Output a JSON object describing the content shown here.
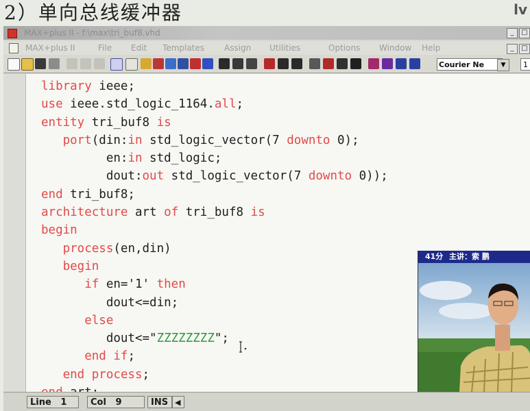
{
  "slide": {
    "title": "2）单向总线缓冲器",
    "corner_text": "lv"
  },
  "window": {
    "title": "MAX+plus II - f:\\max\\tri_buf8.vhd"
  },
  "menu": [
    "MAX+plus II",
    "File",
    "Edit",
    "Templates",
    "Assign",
    "Utilities",
    "Options",
    "Window",
    "Help"
  ],
  "toolbar": {
    "font_name": "Courier Ne",
    "font_size": "1"
  },
  "code_lines": [
    [
      {
        "t": "library",
        "k": "kw"
      },
      {
        "t": " ieee;"
      }
    ],
    [
      {
        "t": "use",
        "k": "kw"
      },
      {
        "t": " ieee.std_logic_1164."
      },
      {
        "t": "all",
        "k": "kw"
      },
      {
        "t": ";"
      }
    ],
    [
      {
        "t": "entity",
        "k": "kw"
      },
      {
        "t": " tri_buf8 "
      },
      {
        "t": "is",
        "k": "kw"
      }
    ],
    [
      {
        "t": "   "
      },
      {
        "t": "port",
        "k": "kw"
      },
      {
        "t": "(din:"
      },
      {
        "t": "in",
        "k": "kw"
      },
      {
        "t": " std_logic_vector(7 "
      },
      {
        "t": "downto",
        "k": "kw"
      },
      {
        "t": " 0);"
      }
    ],
    [
      {
        "t": "         en:"
      },
      {
        "t": "in",
        "k": "kw"
      },
      {
        "t": " std_logic;"
      }
    ],
    [
      {
        "t": "         dout:"
      },
      {
        "t": "out",
        "k": "kw"
      },
      {
        "t": " std_logic_vector(7 "
      },
      {
        "t": "downto",
        "k": "kw"
      },
      {
        "t": " 0));"
      }
    ],
    [
      {
        "t": "end",
        "k": "kw"
      },
      {
        "t": " tri_buf8;"
      }
    ],
    [
      {
        "t": "architecture",
        "k": "kw"
      },
      {
        "t": " art "
      },
      {
        "t": "of",
        "k": "kw"
      },
      {
        "t": " tri_buf8 "
      },
      {
        "t": "is",
        "k": "kw"
      }
    ],
    [
      {
        "t": "begin",
        "k": "kw"
      }
    ],
    [
      {
        "t": "   "
      },
      {
        "t": "process",
        "k": "kw"
      },
      {
        "t": "(en,din)"
      }
    ],
    [
      {
        "t": "   "
      },
      {
        "t": "begin",
        "k": "kw"
      }
    ],
    [
      {
        "t": "      "
      },
      {
        "t": "if",
        "k": "kw"
      },
      {
        "t": " en='1' "
      },
      {
        "t": "then",
        "k": "kw"
      }
    ],
    [
      {
        "t": "         dout<=din;"
      }
    ],
    [
      {
        "t": "      "
      },
      {
        "t": "else",
        "k": "kw"
      }
    ],
    [
      {
        "t": "         dout<=\""
      },
      {
        "t": "ZZZZZZZZ",
        "k": "str"
      },
      {
        "t": "\";"
      }
    ],
    [
      {
        "t": "      "
      },
      {
        "t": "end if",
        "k": "kw"
      },
      {
        "t": ";"
      }
    ],
    [
      {
        "t": "   "
      },
      {
        "t": "end process",
        "k": "kw"
      },
      {
        "t": ";"
      }
    ],
    [
      {
        "t": "end",
        "k": "kw"
      },
      {
        "t": " art;"
      }
    ]
  ],
  "status": {
    "line_label": "Line",
    "line_value": "1",
    "col_label": "Col",
    "col_value": "9",
    "mode": "INS"
  },
  "video": {
    "time": "41分",
    "lecturer": "主讲：索 鹏"
  },
  "colors": {
    "keyword": "#e24a4a",
    "string": "#2a9a3a",
    "video_header": "#1d2a8a"
  }
}
